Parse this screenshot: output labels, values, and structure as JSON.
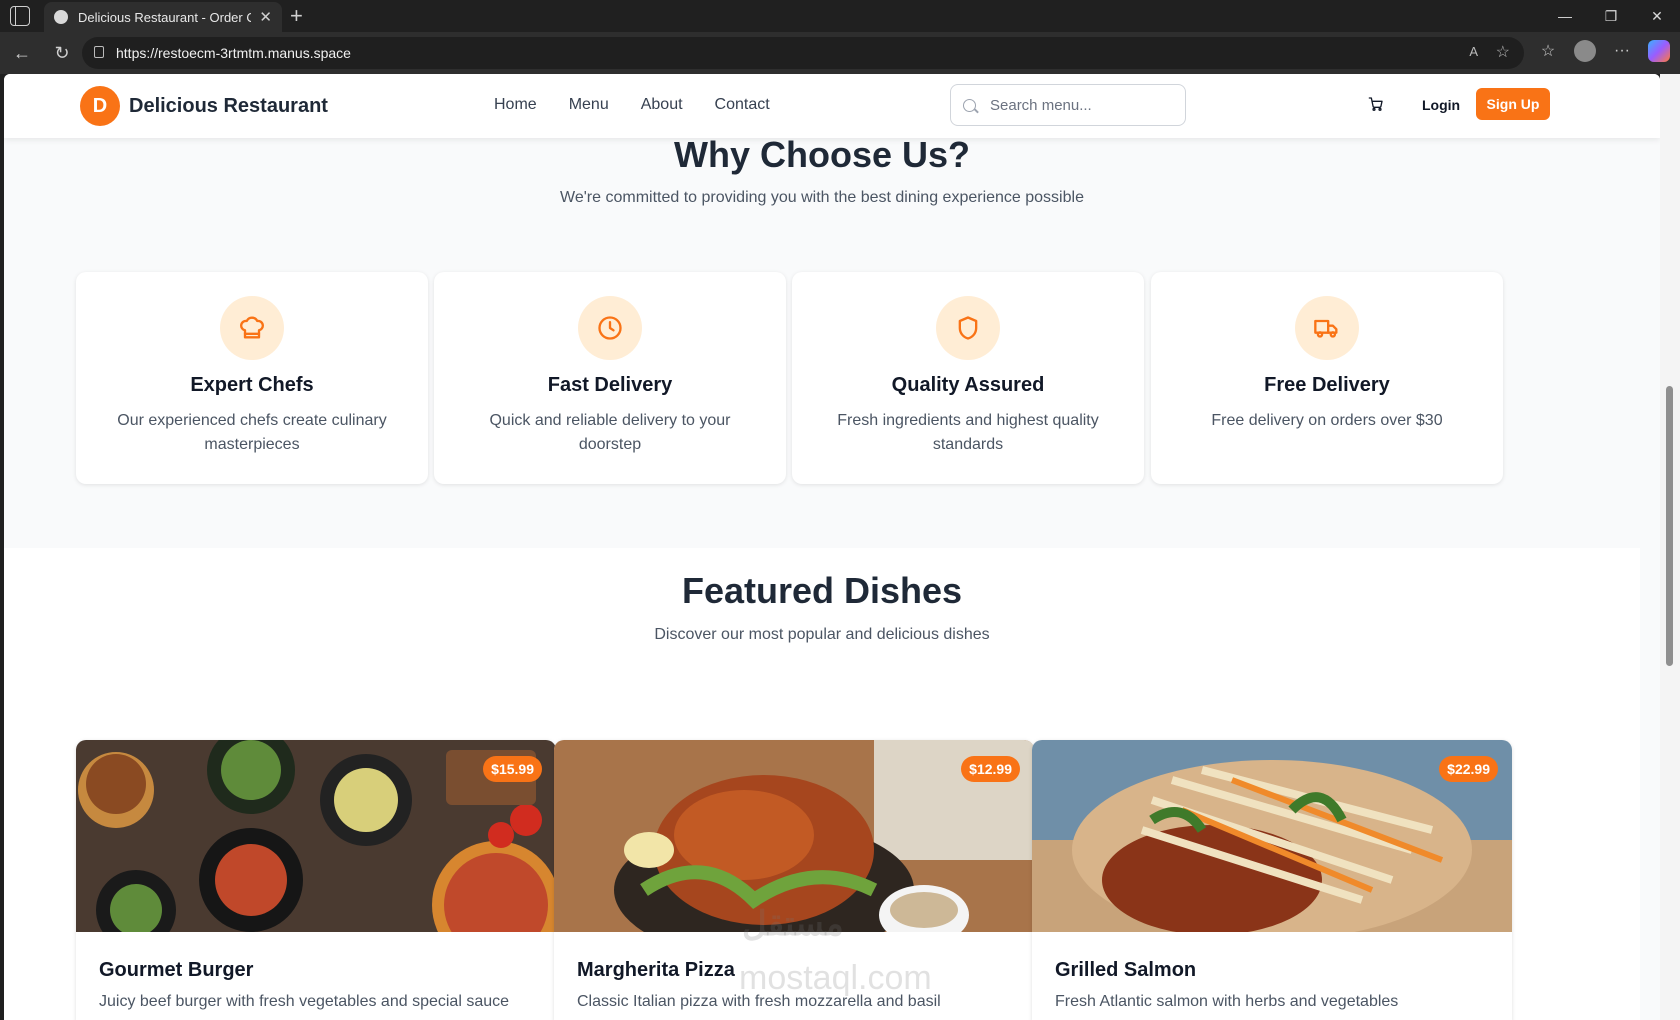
{
  "browser": {
    "tab_title": "Delicious Restaurant - Order Onli",
    "tab_close": "✕",
    "new_tab": "+",
    "url": "https://restoecm-3rtmtm.manus.space",
    "controls": {
      "minimize": "—",
      "restore": "❐",
      "close": "✕"
    }
  },
  "header": {
    "logo_letter": "D",
    "brand": "Delicious Restaurant",
    "nav": [
      "Home",
      "Menu",
      "About",
      "Contact"
    ],
    "search_placeholder": "Search menu...",
    "login": "Login",
    "signup": "Sign Up"
  },
  "why": {
    "title": "Why Choose Us?",
    "subtitle": "We're committed to providing you with the best dining experience possible",
    "features": [
      {
        "icon": "chef-hat-icon",
        "title": "Expert Chefs",
        "desc": "Our experienced chefs create culinary masterpieces"
      },
      {
        "icon": "clock-icon",
        "title": "Fast Delivery",
        "desc": "Quick and reliable delivery to your doorstep"
      },
      {
        "icon": "shield-icon",
        "title": "Quality Assured",
        "desc": "Fresh ingredients and highest quality standards"
      },
      {
        "icon": "truck-icon",
        "title": "Free Delivery",
        "desc": "Free delivery on orders over $30"
      }
    ]
  },
  "featured": {
    "title": "Featured Dishes",
    "subtitle": "Discover our most popular and delicious dishes",
    "dishes": [
      {
        "name": "Gourmet Burger",
        "desc": "Juicy beef burger with fresh vegetables and special sauce",
        "price": "$15.99"
      },
      {
        "name": "Margherita Pizza",
        "desc": "Classic Italian pizza with fresh mozzarella and basil",
        "price": "$12.99"
      },
      {
        "name": "Grilled Salmon",
        "desc": "Fresh Atlantic salmon with herbs and vegetables",
        "price": "$22.99"
      }
    ]
  },
  "watermark": {
    "arabic": "مستقل",
    "latin": "mostaql.com"
  },
  "colors": {
    "accent": "#f97316",
    "icon_bg": "#ffedd5",
    "heading": "#1f2937"
  }
}
